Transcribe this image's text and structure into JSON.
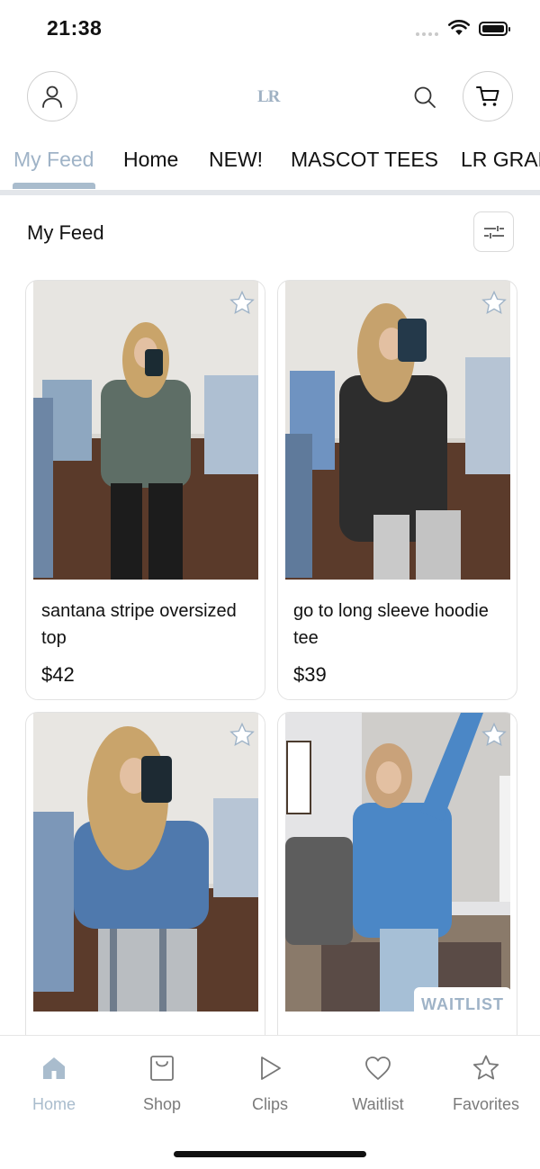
{
  "status_bar": {
    "time": "21:38"
  },
  "header": {
    "logo": "LR"
  },
  "tabs": [
    {
      "label": "My Feed",
      "active": true
    },
    {
      "label": "Home"
    },
    {
      "label": "NEW!"
    },
    {
      "label": "MASCOT TEES"
    },
    {
      "label": "LR GRAP"
    }
  ],
  "feed": {
    "title": "My Feed"
  },
  "products": [
    {
      "name": "santana stripe oversized top",
      "price": "$42"
    },
    {
      "name": "go to long sleeve hoodie tee",
      "price": "$39"
    },
    {
      "name": "",
      "price": ""
    },
    {
      "name": "",
      "price": "",
      "badge": "WAITLIST"
    }
  ],
  "bottom_nav": [
    {
      "label": "Home",
      "icon": "home-icon",
      "active": true
    },
    {
      "label": "Shop",
      "icon": "shopping-bag-icon"
    },
    {
      "label": "Clips",
      "icon": "play-icon"
    },
    {
      "label": "Waitlist",
      "icon": "heart-icon"
    },
    {
      "label": "Favorites",
      "icon": "star-icon"
    }
  ],
  "colors": {
    "accent": "#a9bccd",
    "text": "#111111",
    "muted": "#7b7b7b",
    "border": "#e2e2e2"
  }
}
